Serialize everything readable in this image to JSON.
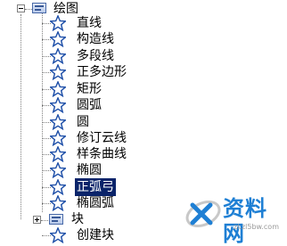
{
  "tree": {
    "root": {
      "label": "绘图",
      "expanded": true
    },
    "items": [
      {
        "label": "直线",
        "icon": "star-icon"
      },
      {
        "label": "构造线",
        "icon": "star-icon"
      },
      {
        "label": "多段线",
        "icon": "star-icon"
      },
      {
        "label": "正多边形",
        "icon": "star-icon"
      },
      {
        "label": "矩形",
        "icon": "star-icon"
      },
      {
        "label": "圆弧",
        "icon": "star-icon"
      },
      {
        "label": "圆",
        "icon": "star-icon"
      },
      {
        "label": "修订云线",
        "icon": "star-icon"
      },
      {
        "label": "样条曲线",
        "icon": "star-icon"
      },
      {
        "label": "椭圆",
        "icon": "star-icon"
      },
      {
        "label": "正弧弓",
        "icon": "star-icon",
        "selected": true
      },
      {
        "label": "椭圆弧",
        "icon": "star-icon"
      }
    ],
    "sibling": {
      "label": "块",
      "expanded": false
    },
    "partial": {
      "label": "创建块",
      "icon": "star-icon"
    }
  },
  "watermark": {
    "text": "资料网",
    "url": "zl.zl5bw.com"
  },
  "colors": {
    "selection": "#0a246a",
    "star": "#1e4fa8",
    "watermark": "#1e7fd4"
  }
}
